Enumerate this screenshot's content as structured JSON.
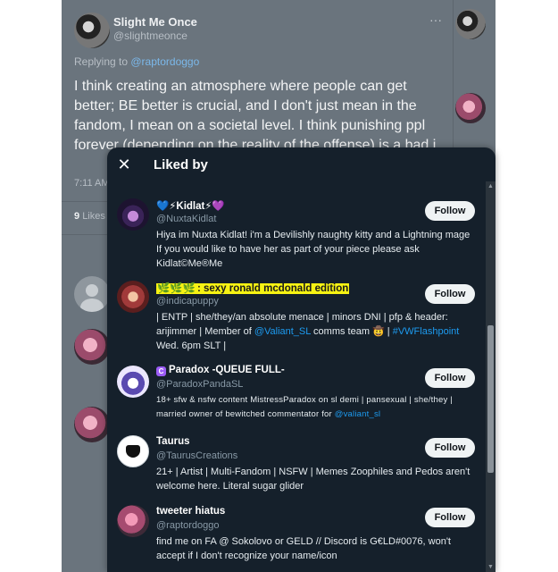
{
  "background_tweet": {
    "name": "Slight Me Once",
    "handle": "@slightmeonce",
    "more": "···",
    "replying_prefix": "Replying to ",
    "replying_to": "@raptordoggo",
    "body": "I think creating an atmosphere where people can get better; BE better is crucial, and I don't just mean in the fandom, I mean on a societal level. I think punishing ppl forever (depending on the reality of the offense) is a bad i",
    "time": "7:11 AM",
    "likes_count": "9",
    "likes_label": "Likes"
  },
  "modal": {
    "title": "Liked by",
    "close_icon": "✕",
    "follow_label": "Follow",
    "users": [
      {
        "name_prefix": "💙⚡",
        "name": "Kidlat⚡💜",
        "handle": "@NuxtaKidlat",
        "bio": "Hiya im Nuxta Kidlat! i'm a Devilishly naughty kitty and a Lightning mage If you would like to have her as part of your piece please ask Kidlat©Me®Me"
      },
      {
        "name_highlight": "🌿🌿🌿",
        "name": ": sexy ronald mcdonald edition",
        "handle": "@indicapuppy",
        "bio_part1": "| ENTP | she/they/an absolute menace | minors DNI | pfp & header: arijimmer | Member of ",
        "bio_link1": "@Valiant_SL",
        "bio_part2": " comms team 🤠 | ",
        "bio_link2": "#VWFlashpoint",
        "bio_part3": " Wed. 6pm SLT |"
      },
      {
        "badge": "C",
        "name": "Paradox -QUEUE FULL-",
        "handle": "@ParadoxPandaSL",
        "bio_part1": "18+ sfw & nsfw content MistressParadox on sl demi | pansexual | she/they | married owner of bewitched commentator for ",
        "bio_link1": "@valiant_sl"
      },
      {
        "name": "Taurus",
        "handle": "@TaurusCreations",
        "bio": "21+ | Artist | Multi-Fandom | NSFW | Memes Zoophiles and Pedos aren't welcome here. Literal sugar glider"
      },
      {
        "name": "tweeter hiatus",
        "handle": "@raptordoggo",
        "bio": "find me on FA @ Sokolovo or GELD // Discord is G€LD#0076, won't accept if I don't recognize your name/icon"
      }
    ]
  }
}
